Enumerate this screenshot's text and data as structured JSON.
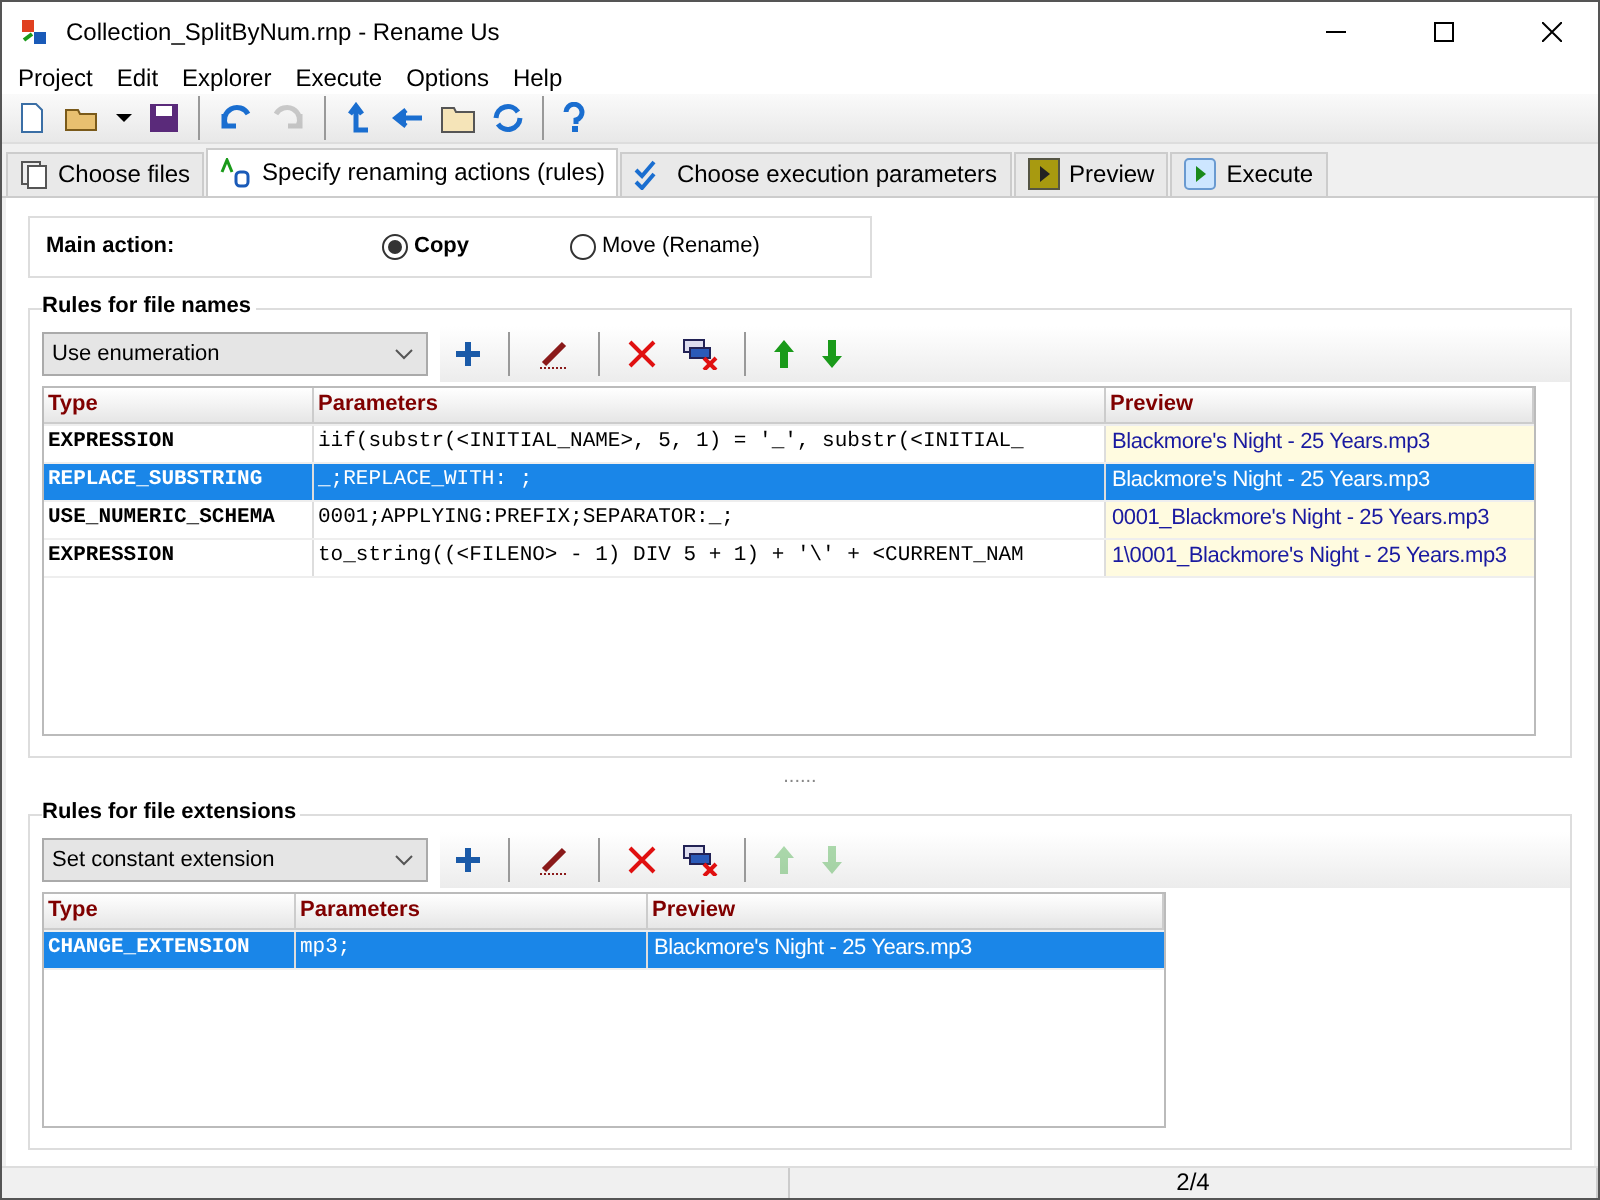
{
  "window": {
    "title": "Collection_SplitByNum.rnp - Rename Us"
  },
  "menu": [
    "Project",
    "Edit",
    "Explorer",
    "Execute",
    "Options",
    "Help"
  ],
  "toolbar": [
    {
      "kind": "new",
      "disabled": false
    },
    {
      "kind": "open",
      "disabled": false
    },
    {
      "kind": "dropdown",
      "disabled": false
    },
    {
      "kind": "save",
      "disabled": false
    },
    {
      "kind": "sep"
    },
    {
      "kind": "undo",
      "disabled": false
    },
    {
      "kind": "redo",
      "disabled": true
    },
    {
      "kind": "sep"
    },
    {
      "kind": "up",
      "disabled": false
    },
    {
      "kind": "back",
      "disabled": false
    },
    {
      "kind": "folder",
      "disabled": false
    },
    {
      "kind": "refresh",
      "disabled": false
    },
    {
      "kind": "sep"
    },
    {
      "kind": "help",
      "disabled": false
    }
  ],
  "tabs": [
    {
      "label": "Choose files",
      "kind": "files",
      "selected": false
    },
    {
      "label": "Specify renaming actions (rules)",
      "kind": "rules",
      "selected": true
    },
    {
      "label": "Choose execution parameters",
      "kind": "params",
      "selected": false
    },
    {
      "label": "Preview",
      "kind": "preview",
      "selected": false
    },
    {
      "label": "Execute",
      "kind": "execute",
      "selected": false
    }
  ],
  "main_action": {
    "label": "Main action:",
    "options": [
      {
        "label": "Copy",
        "selected": true
      },
      {
        "label": "Move (Rename)",
        "selected": false
      }
    ]
  },
  "name_rules": {
    "title": "Rules for file names",
    "dropdown": "Use enumeration",
    "actions": [
      {
        "kind": "add",
        "disabled": false
      },
      {
        "kind": "sep"
      },
      {
        "kind": "edit",
        "disabled": false
      },
      {
        "kind": "sep"
      },
      {
        "kind": "delete",
        "disabled": false
      },
      {
        "kind": "delete-all",
        "disabled": false
      },
      {
        "kind": "sep"
      },
      {
        "kind": "move-up",
        "disabled": false
      },
      {
        "kind": "move-down",
        "disabled": false
      }
    ],
    "columns": [
      "Type",
      "Parameters",
      "Preview"
    ],
    "rows": [
      {
        "type": "EXPRESSION",
        "parameters": "iif(substr(<INITIAL_NAME>, 5, 1) = '_', substr(<INITIAL_",
        "preview": "Blackmore's Night - 25 Years.mp3",
        "selected": false
      },
      {
        "type": "REPLACE_SUBSTRING",
        "parameters": "_;REPLACE_WITH: ;",
        "preview": "Blackmore's Night - 25 Years.mp3",
        "selected": true
      },
      {
        "type": "USE_NUMERIC_SCHEMA",
        "parameters": "0001;APPLYING:PREFIX;SEPARATOR:_;",
        "preview": "0001_Blackmore's Night - 25 Years.mp3",
        "selected": false
      },
      {
        "type": "EXPRESSION",
        "parameters": "to_string((<FILENO> - 1) DIV 5 + 1) + '\\' + <CURRENT_NAM",
        "preview": "1\\0001_Blackmore's Night - 25 Years.mp3",
        "selected": false
      }
    ]
  },
  "splitter": "......",
  "ext_rules": {
    "title": "Rules for file extensions",
    "dropdown": "Set constant extension",
    "actions": [
      {
        "kind": "add",
        "disabled": false
      },
      {
        "kind": "sep"
      },
      {
        "kind": "edit",
        "disabled": false
      },
      {
        "kind": "sep"
      },
      {
        "kind": "delete",
        "disabled": false
      },
      {
        "kind": "delete-all",
        "disabled": false
      },
      {
        "kind": "sep"
      },
      {
        "kind": "move-up",
        "disabled": true
      },
      {
        "kind": "move-down",
        "disabled": true
      }
    ],
    "columns": [
      "Type",
      "Parameters",
      "Preview"
    ],
    "rows": [
      {
        "type": "CHANGE_EXTENSION",
        "parameters": "mp3;",
        "preview": "Blackmore's Night - 25 Years.mp3",
        "selected": true
      }
    ]
  },
  "status_bar": {
    "position": "2/4"
  }
}
